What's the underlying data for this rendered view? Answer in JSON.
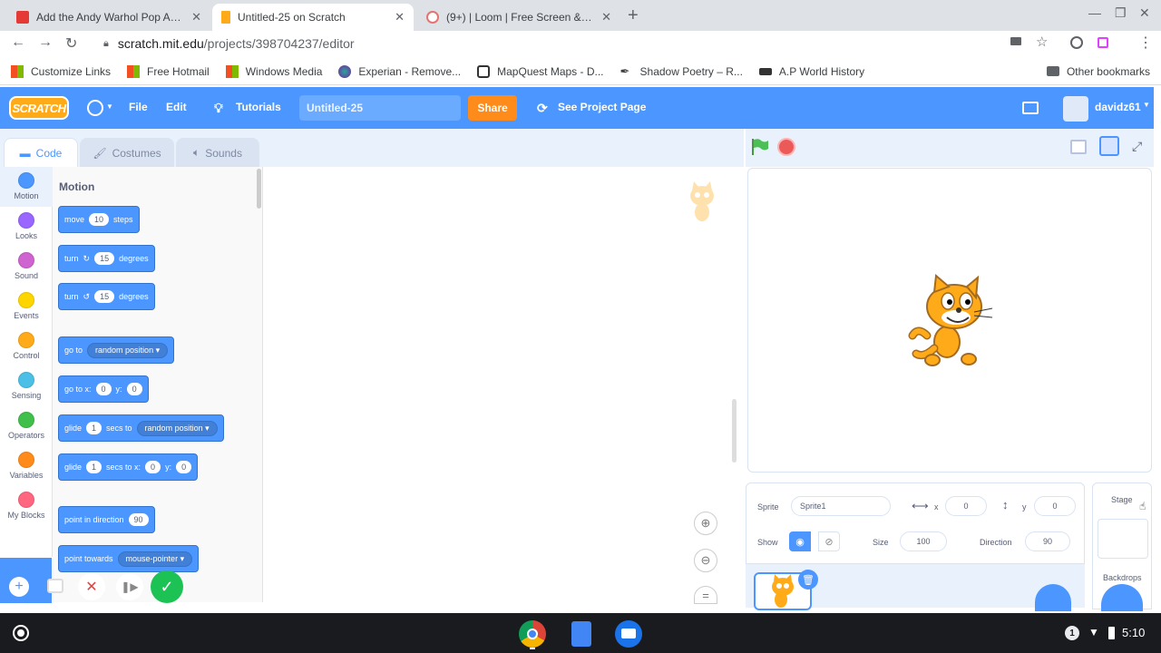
{
  "browser": {
    "tabs": [
      {
        "title": "Add the Andy Warhol Pop Art E",
        "favicon_color": "#e53935",
        "active": false
      },
      {
        "title": "Untitled-25 on Scratch",
        "favicon_color": "#ffab19",
        "active": true
      },
      {
        "title": "(9+) | Loom | Free Screen & Vide",
        "favicon_color": "#e57373",
        "active": false
      }
    ],
    "new_tab_icon": "plus-icon",
    "url_host": "scratch.mit.edu",
    "url_path": "/projects/398704237/editor",
    "bookmarks": [
      {
        "label": "Customize Links",
        "icon": "windows-logo-icon"
      },
      {
        "label": "Free Hotmail",
        "icon": "windows-logo-icon"
      },
      {
        "label": "Windows Media",
        "icon": "windows-logo-icon"
      },
      {
        "label": "Experian - Remove...",
        "icon": "experian-icon"
      },
      {
        "label": "MapQuest Maps - D...",
        "icon": "mapquest-icon"
      },
      {
        "label": "Shadow Poetry – R...",
        "icon": "quill-icon"
      },
      {
        "label": "A.P World History",
        "icon": "mask-icon"
      }
    ],
    "other_bookmarks": "Other bookmarks"
  },
  "scratch": {
    "logo": "SCRATCH",
    "menu": {
      "file": "File",
      "edit": "Edit",
      "tutorials": "Tutorials",
      "see_project": "See Project Page",
      "username": "davidz61"
    },
    "project_title": "Untitled-25",
    "share": "Share",
    "editor_tabs": {
      "code": "Code",
      "costumes": "Costumes",
      "sounds": "Sounds"
    },
    "categories": [
      {
        "label": "Motion",
        "color": "#4c97ff"
      },
      {
        "label": "Looks",
        "color": "#9966ff"
      },
      {
        "label": "Sound",
        "color": "#cf63cf"
      },
      {
        "label": "Events",
        "color": "#ffd500"
      },
      {
        "label": "Control",
        "color": "#ffab19"
      },
      {
        "label": "Sensing",
        "color": "#4cbfe6"
      },
      {
        "label": "Operators",
        "color": "#40bf4a"
      },
      {
        "label": "Variables",
        "color": "#ff8c1a"
      },
      {
        "label": "My Blocks",
        "color": "#ff6680"
      }
    ],
    "palette_title": "Motion",
    "blocks": {
      "move": {
        "a": "move",
        "n": "10",
        "b": "steps"
      },
      "turn_right": {
        "a": "turn",
        "n": "15",
        "b": "degrees"
      },
      "turn_left": {
        "a": "turn",
        "n": "15",
        "b": "degrees"
      },
      "goto": {
        "a": "go to",
        "d": "random position"
      },
      "goto_xy": {
        "a": "go to x:",
        "x": "0",
        "b": "y:",
        "y": "0"
      },
      "glide_to": {
        "a": "glide",
        "n": "1",
        "b": "secs to",
        "d": "random position"
      },
      "glide_xy": {
        "a": "glide",
        "n": "1",
        "b": "secs to x:",
        "x": "0",
        "c": "y:",
        "y": "0"
      },
      "point_dir": {
        "a": "point in direction",
        "n": "90"
      },
      "point_towards": {
        "a": "point towards",
        "d": "mouse-pointer"
      }
    },
    "sprite_info": {
      "sprite_label": "Sprite",
      "sprite_name": "Sprite1",
      "x_label": "x",
      "x": "0",
      "y_label": "y",
      "y": "0",
      "show_label": "Show",
      "size_label": "Size",
      "size": "100",
      "direction_label": "Direction",
      "direction": "90"
    },
    "stage_panel": {
      "title": "Stage",
      "backdrops": "Backdrops"
    }
  },
  "shelf": {
    "time": "5:10",
    "notification_count": "1"
  }
}
